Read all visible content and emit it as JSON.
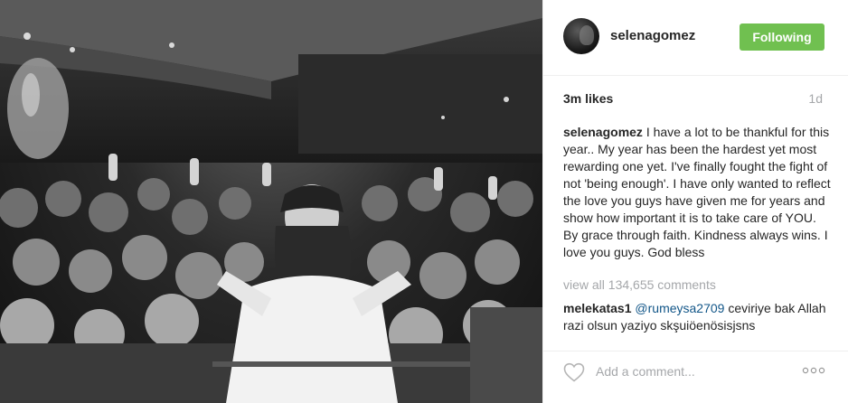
{
  "post": {
    "photo_alt": "",
    "header": {
      "username": "selenagomez",
      "follow_label": "Following"
    },
    "likes": "3m likes",
    "time": "1d",
    "caption": {
      "username": "selenagomez",
      "text": "I have a lot to be thankful for this year.. My year has been the hardest yet most rewarding one yet. I've finally fought the fight of not 'being enough'. I have only wanted to reflect the love you guys have given me for years and show how important it is to take care of YOU. By grace through faith. Kindness always wins. I love you guys. God bless"
    },
    "view_all_comments": "view all 134,655 comments",
    "comments": [
      {
        "username": "melekatas1",
        "mention": "@rumeysa2709",
        "text": "ceviriye bak Allah razi olsun yaziyo skşuiöenösisjsns"
      }
    ],
    "footer": {
      "like_icon": "heart-outline-icon",
      "comment_placeholder": "Add a comment...",
      "more_icon": "ellipsis-icon"
    },
    "colors": {
      "follow_button": "#70c050",
      "mention": "#125688",
      "muted": "#a5a7aa",
      "text": "#262626"
    }
  }
}
